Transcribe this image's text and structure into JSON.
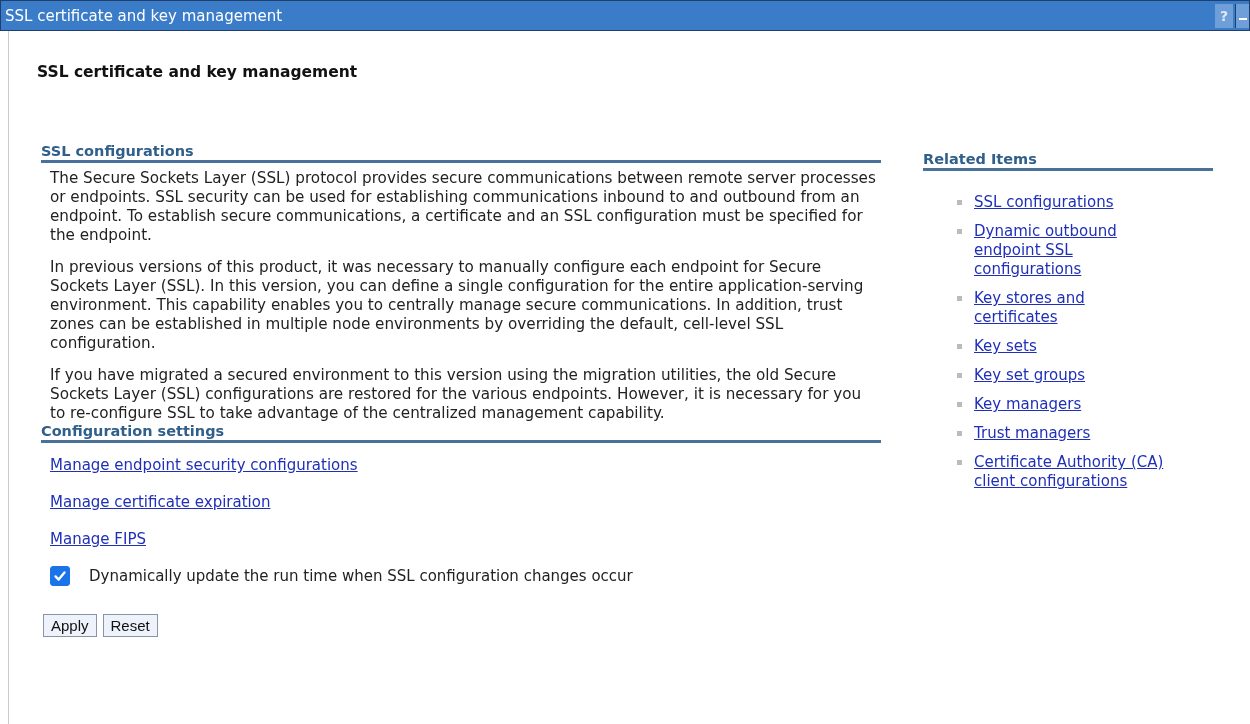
{
  "window": {
    "title": "SSL certificate and key management",
    "help_label": "?"
  },
  "page_title": "SSL certificate and key management",
  "main": {
    "sections": [
      {
        "kind": "text",
        "heading": "SSL configurations",
        "paragraphs": [
          "The Secure Sockets Layer (SSL) protocol provides secure communications between remote server processes or endpoints. SSL security can be used for establishing communications inbound to and outbound from an endpoint. To establish secure communications, a certificate and an SSL configuration must be specified for the endpoint.",
          "In previous versions of this product, it was necessary to manually configure each endpoint for Secure Sockets Layer (SSL). In this version, you can define a single configuration for the entire application-serving environment. This capability enables you to centrally manage secure communications. In addition, trust zones can be established in multiple node environments by overriding the default, cell-level SSL configuration.",
          "If you have migrated a secured environment to this version using the migration utilities, the old Secure Sockets Layer (SSL) configurations are restored for the various endpoints. However, it is necessary for you to re-configure SSL to take advantage of the centralized management capability."
        ]
      },
      {
        "kind": "links",
        "heading": "Configuration settings",
        "links": [
          "Manage endpoint security configurations",
          "Manage certificate expiration",
          "Manage FIPS"
        ]
      }
    ],
    "checkbox": {
      "label": "Dynamically update the run time when SSL configuration changes occur",
      "checked": true
    },
    "buttons": [
      "Apply",
      "Reset"
    ]
  },
  "related": {
    "heading": "Related Items",
    "items": [
      "SSL configurations",
      "Dynamic outbound endpoint SSL configurations",
      "Key stores and certificates",
      "Key sets",
      "Key set groups",
      "Key managers",
      "Trust managers",
      "Certificate Authority (CA) client configurations"
    ]
  }
}
